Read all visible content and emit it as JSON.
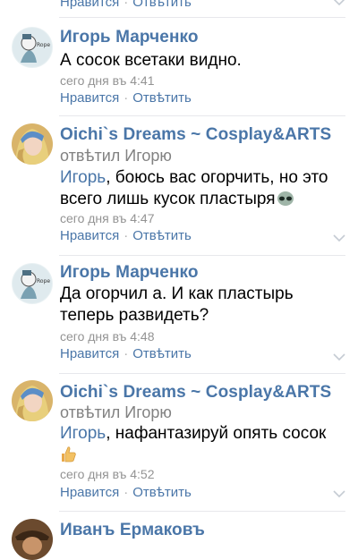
{
  "comments": [
    {
      "author": "",
      "text": "",
      "time": "",
      "like": "Нравится",
      "reply": "Отвѣтить"
    },
    {
      "author": "Игорь Марченко",
      "text": "А сосок всетаки видно.",
      "time": "сего дня въ 4:41",
      "like": "Нравится",
      "reply": "Отвѣтить"
    },
    {
      "author": "Oichi`s Dreams ~ Cosplay&ARTS",
      "reply_to": "отвѣтил Игорю",
      "mention": "Игорь",
      "text": ", боюсь вас огорчить, но это всего лишь кусок пластыря",
      "time": "сего дня въ 4:47",
      "like": "Нравится",
      "reply": "Отвѣтить"
    },
    {
      "author": "Игорь Марченко",
      "text": "Да огорчил а. И как пластырь теперь развидеть?",
      "time": "сего дня въ 4:48",
      "like": "Нравится",
      "reply": "Отвѣтить"
    },
    {
      "author": "Oichi`s Dreams ~ Cosplay&ARTS",
      "reply_to": "отвѣтил Игорю",
      "mention": "Игорь",
      "text": ", нафантазируй опять сосок",
      "time": "сего дня въ 4:52",
      "like": "Нравится",
      "reply": "Отвѣтить"
    },
    {
      "author": "Иванъ Ермаковъ"
    }
  ],
  "colors": {
    "link": "#4a76a8",
    "meta": "#939393",
    "divider": "#e7e8ec"
  },
  "icons": [
    "chevron-down-icon",
    "alien-emoji-icon",
    "thumbs-up-emoji-icon"
  ]
}
